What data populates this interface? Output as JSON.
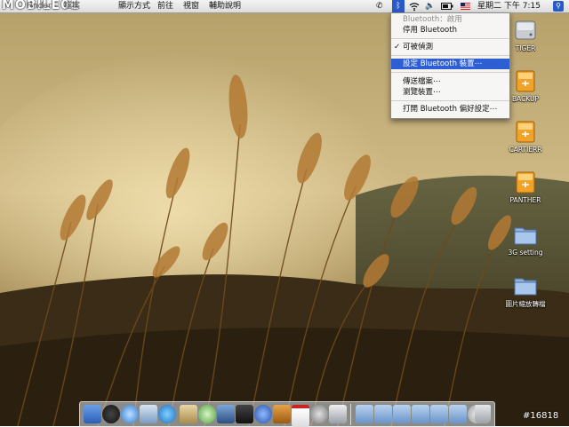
{
  "menubar": {
    "logo": "MOBILE01",
    "items": [
      "Finder",
      "檔案",
      "顯示方式",
      "前往",
      "視窗",
      "輔助說明"
    ],
    "clock": "星期二 下午 7:15"
  },
  "bluetooth_menu": {
    "items": [
      {
        "label": "Bluetooth：啟用",
        "enabled": false
      },
      {
        "label": "停用 Bluetooth",
        "enabled": true
      },
      {
        "label": "可被偵測",
        "enabled": true,
        "checked": true
      },
      {
        "label": "設定 Bluetooth 裝置⋯",
        "enabled": true,
        "highlighted": true
      },
      {
        "label": "傳送檔案⋯",
        "enabled": true
      },
      {
        "label": "瀏覽裝置⋯",
        "enabled": true
      },
      {
        "label": "打開 Bluetooth 偏好設定⋯",
        "enabled": true
      }
    ],
    "checkmark": "✓"
  },
  "desktop_icons": [
    {
      "label": "TIGER",
      "kind": "hard-disk"
    },
    {
      "label": "BACKUP",
      "kind": "external-disk"
    },
    {
      "label": "CARTIERR",
      "kind": "external-disk"
    },
    {
      "label": "PANTHER",
      "kind": "external-disk"
    },
    {
      "label": "3G setting",
      "kind": "folder"
    },
    {
      "label": "圖片縮放轉檔",
      "kind": "folder"
    }
  ],
  "dock_apps": [
    "finder",
    "dashboard",
    "safari",
    "mail",
    "ichat",
    "address-book",
    "itunes",
    "iphoto",
    "imovie",
    "system-preferences",
    "garageband",
    "ical",
    "time-machine",
    "application",
    "documents",
    "downloads",
    "applications-folder",
    "pictures",
    "movies",
    "music",
    "stack",
    "trash"
  ],
  "watermark": "#16818",
  "colors": {
    "highlight": "#2d5fd3",
    "menubar": "#e6e6e6"
  }
}
